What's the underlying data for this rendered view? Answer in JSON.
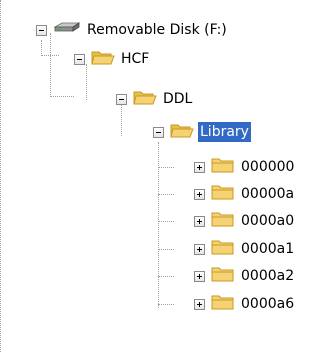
{
  "tree": {
    "drive": {
      "label": "Removable Disk (F:)",
      "icon": "removable-disk-icon",
      "expanded": true
    },
    "folders": [
      {
        "label": "HCF",
        "icon": "folder-open-icon",
        "expanded": true
      },
      {
        "label": "DDL",
        "icon": "folder-open-icon",
        "expanded": true
      },
      {
        "label": "Library",
        "icon": "folder-open-icon",
        "expanded": true,
        "selected": true
      }
    ],
    "children": [
      {
        "label": "000000",
        "icon": "folder-closed-icon",
        "expanded": false
      },
      {
        "label": "00000a",
        "icon": "folder-closed-icon",
        "expanded": false
      },
      {
        "label": "0000a0",
        "icon": "folder-closed-icon",
        "expanded": false
      },
      {
        "label": "0000a1",
        "icon": "folder-closed-icon",
        "expanded": false
      },
      {
        "label": "0000a2",
        "icon": "folder-closed-icon",
        "expanded": false
      },
      {
        "label": "0000a6",
        "icon": "folder-closed-icon",
        "expanded": false
      }
    ]
  },
  "colors": {
    "selection": "#316ac5",
    "folder": "#f5d374",
    "folder_edge": "#c79a1e",
    "tree_lines": "#a0a0a0"
  }
}
